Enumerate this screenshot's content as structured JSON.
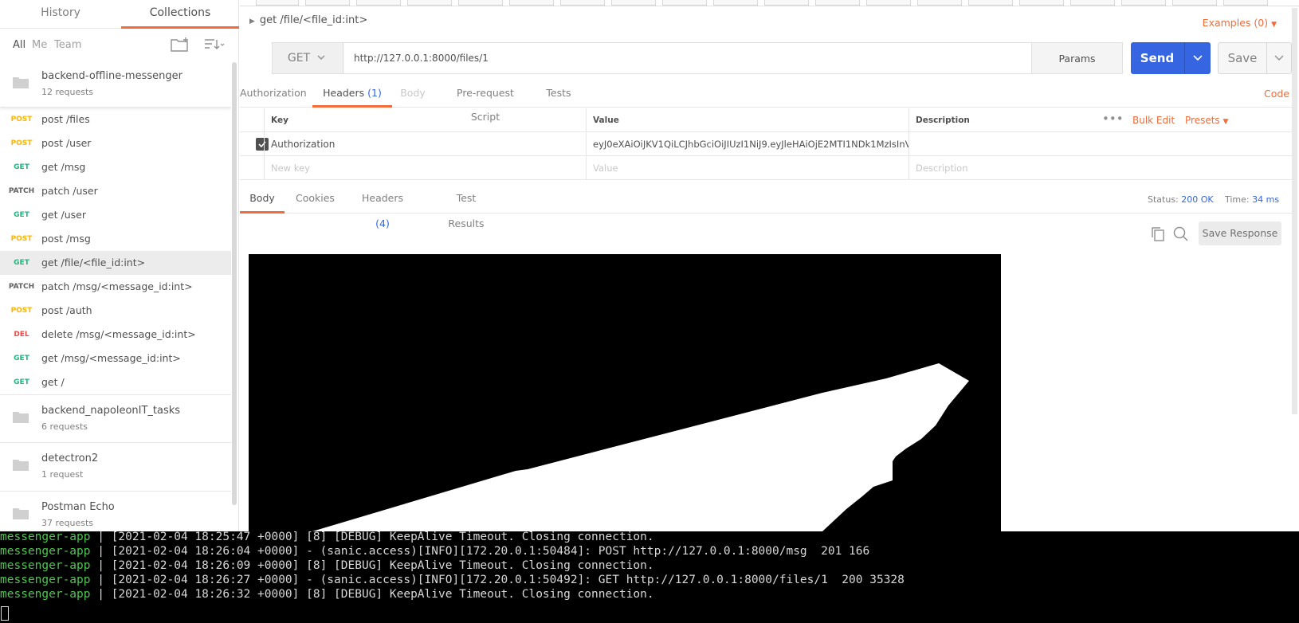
{
  "sidebar": {
    "tabs": [
      "History",
      "Collections"
    ],
    "filters": [
      "All",
      "Me",
      "Team"
    ],
    "collections": [
      {
        "name": "backend-offline-messenger",
        "count": "12 requests"
      },
      {
        "name": "backend_napoleonIT_tasks",
        "count": "6 requests"
      },
      {
        "name": "detectron2",
        "count": "1 request"
      },
      {
        "name": "Postman Echo",
        "count": "37 requests"
      }
    ],
    "requests": [
      {
        "method": "POST",
        "name": "post /files"
      },
      {
        "method": "POST",
        "name": "post /user"
      },
      {
        "method": "GET",
        "name": "get /msg"
      },
      {
        "method": "PATCH",
        "name": "patch /user"
      },
      {
        "method": "GET",
        "name": "get /user"
      },
      {
        "method": "POST",
        "name": "post /msg"
      },
      {
        "method": "GET",
        "name": "get /file/<file_id:int>"
      },
      {
        "method": "PATCH",
        "name": "patch /msg/<message_id:int>"
      },
      {
        "method": "POST",
        "name": "post /auth"
      },
      {
        "method": "DEL",
        "name": "delete /msg/<message_id:int>"
      },
      {
        "method": "GET",
        "name": "get /msg/<message_id:int>"
      },
      {
        "method": "GET",
        "name": "get /"
      }
    ],
    "method_colors": {
      "POST": "#ffb400",
      "GET": "#26b47f",
      "PATCH": "#606060",
      "DEL": "#ed4b48"
    }
  },
  "request": {
    "name": "get /file/<file_id:int>",
    "examples": "Examples (0)",
    "method": "GET",
    "url": "http://127.0.0.1:8000/files/1",
    "params_label": "Params",
    "send_label": "Send",
    "save_label": "Save",
    "tabs": {
      "authorization": "Authorization",
      "headers": "Headers",
      "headers_count": "(1)",
      "body": "Body",
      "prerequest": "Pre-request Script",
      "tests": "Tests"
    },
    "code_label": "Code"
  },
  "headers_table": {
    "columns": [
      "Key",
      "Value",
      "Description"
    ],
    "bulk_edit": "Bulk Edit",
    "presets": "Presets",
    "rows": [
      {
        "key": "Authorization",
        "value": "eyJ0eXAiOiJKV1QiLCJhbGciOiJIUzI1NiJ9.eyJleHAiOjE2MTI1NDk1MzIsInVp...",
        "description": "",
        "checked": true
      }
    ],
    "placeholder": {
      "key": "New key",
      "value": "Value",
      "description": "Description"
    }
  },
  "response": {
    "tabs": {
      "body": "Body",
      "cookies": "Cookies",
      "headers": "Headers",
      "headers_count": "(4)",
      "test_results": "Test Results"
    },
    "status_label": "Status:",
    "status_value": "200 OK",
    "time_label": "Time:",
    "time_value": "34 ms",
    "save_response": "Save Response"
  },
  "terminal": {
    "app": "messenger-app",
    "lines": [
      " | [2021-02-04 18:25:47 +0000] [8] [DEBUG] KeepAlive Timeout. Closing connection.",
      " | [2021-02-04 18:26:04 +0000] - (sanic.access)[INFO][172.20.0.1:50484]: POST http://127.0.0.1:8000/msg  201 166",
      " | [2021-02-04 18:26:09 +0000] [8] [DEBUG] KeepAlive Timeout. Closing connection.",
      " | [2021-02-04 18:26:27 +0000] - (sanic.access)[INFO][172.20.0.1:50492]: GET http://127.0.0.1:8000/files/1  200 35328",
      " | [2021-02-04 18:26:32 +0000] [8] [DEBUG] KeepAlive Timeout. Closing connection."
    ]
  },
  "colors": {
    "accent": "#f26b3a",
    "send": "#3565e0",
    "terminal_app": "#4ec64e"
  }
}
